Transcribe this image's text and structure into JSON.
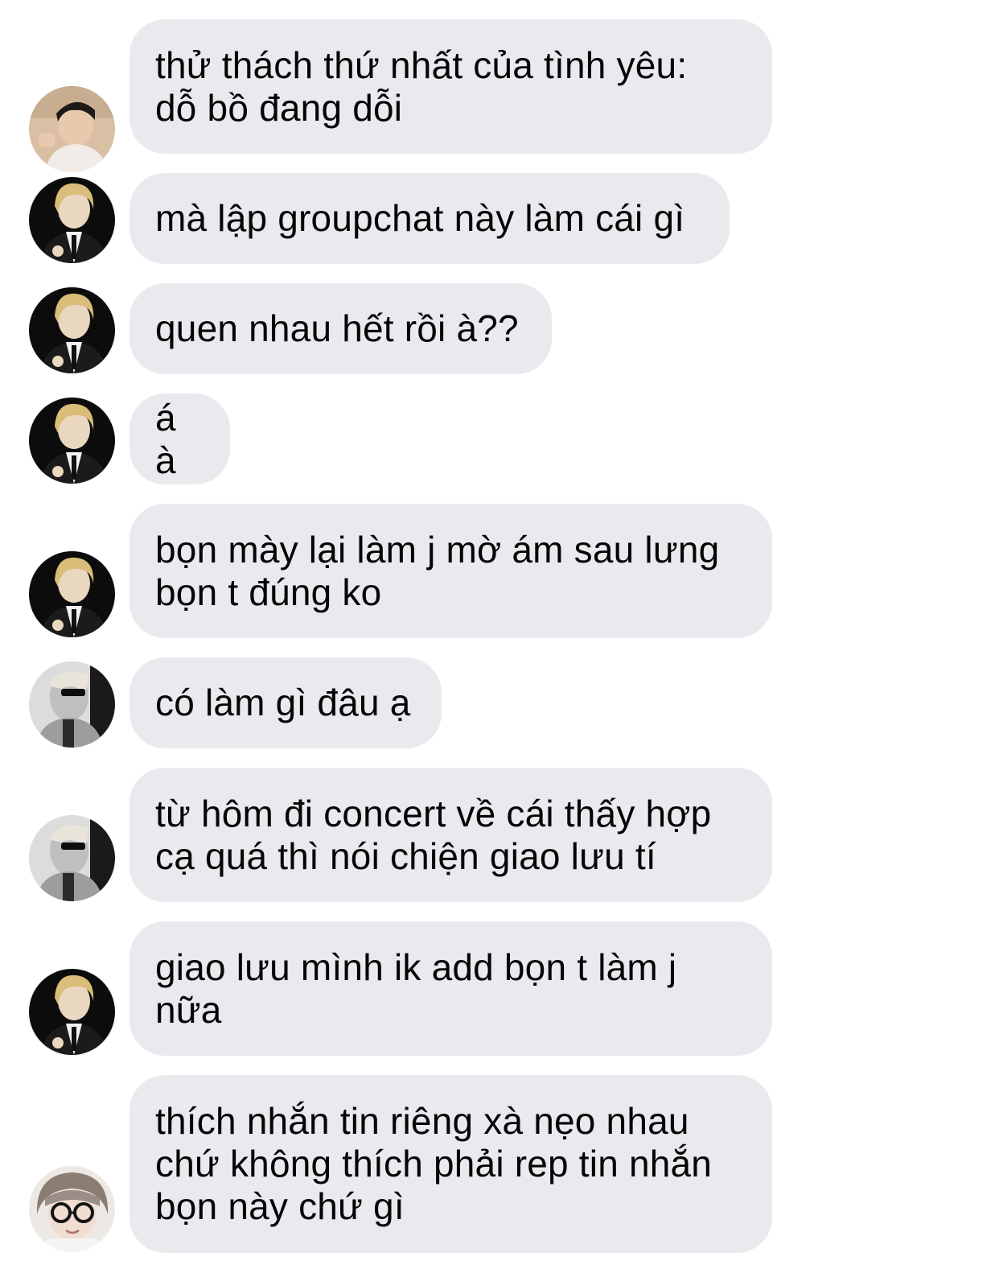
{
  "messages": [
    {
      "avatar": "avatar-beach-boy",
      "text": "thử thách thứ nhất của tình yêu:\ndỗ bồ đang dỗi"
    },
    {
      "avatar": "avatar-blonde-suit",
      "text": "mà lập groupchat này làm cái gì"
    },
    {
      "avatar": "avatar-blonde-suit",
      "text": "quen nhau hết rồi à??"
    },
    {
      "avatar": "avatar-blonde-suit",
      "text": "á à"
    },
    {
      "avatar": "avatar-blonde-suit",
      "text": "bọn mày lại làm j mờ ám sau lưng\nbọn t đúng ko"
    },
    {
      "avatar": "avatar-sunglasses-blur",
      "text": "có làm gì đâu ạ"
    },
    {
      "avatar": "avatar-sunglasses-blur",
      "text": "từ hôm đi concert về cái thấy hợp\ncạ quá thì nói chiện giao lưu tí"
    },
    {
      "avatar": "avatar-blonde-suit",
      "text": "giao lưu mình ik add bọn t làm j\nnữa"
    },
    {
      "avatar": "avatar-glasses-girl",
      "text": "thích nhắn tin riêng xà nẹo nhau\nchứ không thích phải rep tin nhắn\nbọn này chứ gì"
    }
  ],
  "colors": {
    "bubble_bg": "#e9eaee",
    "text": "#050505",
    "background": "#ffffff"
  }
}
